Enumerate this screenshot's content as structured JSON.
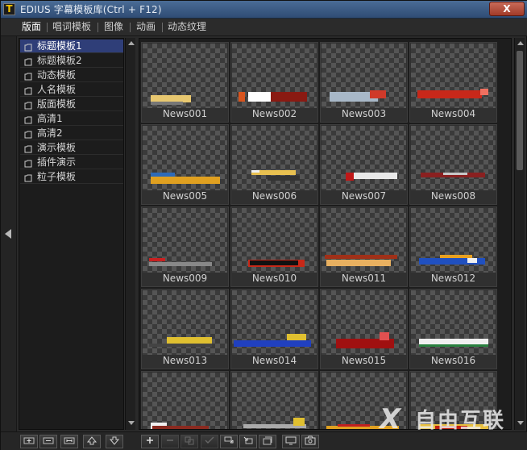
{
  "window": {
    "title": "EDIUS 字幕模板库(Ctrl + F12)",
    "app_icon": "T",
    "close_label": "X"
  },
  "tabs": [
    {
      "label": "版面",
      "active": true
    },
    {
      "label": "唱词模板",
      "active": false
    },
    {
      "label": "图像",
      "active": false
    },
    {
      "label": "动画",
      "active": false
    },
    {
      "label": "动态纹理",
      "active": false
    }
  ],
  "categories": [
    {
      "label": "标题模板1",
      "selected": true
    },
    {
      "label": "标题模板2",
      "selected": false
    },
    {
      "label": "动态模板",
      "selected": false
    },
    {
      "label": "人名模板",
      "selected": false
    },
    {
      "label": "版面模板",
      "selected": false
    },
    {
      "label": "高清1",
      "selected": false
    },
    {
      "label": "高清2",
      "selected": false
    },
    {
      "label": "演示模板",
      "selected": false
    },
    {
      "label": "插件演示",
      "selected": false
    },
    {
      "label": "粒子模板",
      "selected": false
    }
  ],
  "templates": [
    {
      "name": "News001"
    },
    {
      "name": "News002"
    },
    {
      "name": "News003"
    },
    {
      "name": "News004"
    },
    {
      "name": "News005"
    },
    {
      "name": "News006"
    },
    {
      "name": "News007"
    },
    {
      "name": "News008"
    },
    {
      "name": "News009"
    },
    {
      "name": "News010"
    },
    {
      "name": "News011"
    },
    {
      "name": "News012"
    },
    {
      "name": "News013"
    },
    {
      "name": "News014"
    },
    {
      "name": "News015"
    },
    {
      "name": "News016"
    },
    {
      "name": ""
    },
    {
      "name": ""
    },
    {
      "name": ""
    },
    {
      "name": ""
    }
  ],
  "left_toolbar": [
    {
      "icon": "add-category-icon"
    },
    {
      "icon": "remove-category-icon"
    },
    {
      "icon": "rename-icon"
    },
    {
      "icon": "move-up-icon"
    },
    {
      "icon": "move-down-icon"
    }
  ],
  "right_toolbar": [
    {
      "icon": "add-template-icon",
      "disabled": false
    },
    {
      "icon": "delete-template-icon",
      "disabled": true
    },
    {
      "icon": "copy-icon",
      "disabled": true
    },
    {
      "icon": "apply-icon",
      "disabled": true
    },
    {
      "icon": "export-icon",
      "disabled": false
    },
    {
      "icon": "import-icon",
      "disabled": false
    },
    {
      "icon": "batch-icon",
      "disabled": false
    },
    {
      "icon": "preview-icon",
      "disabled": false
    },
    {
      "icon": "snapshot-icon",
      "disabled": false
    }
  ],
  "watermark": {
    "mark": "X",
    "text": "自由互联"
  },
  "colors": {
    "title_bar": "#3b5b85",
    "selection": "#2f3e78",
    "checker_light": "#555555",
    "checker_dark": "#3a3a3a"
  }
}
